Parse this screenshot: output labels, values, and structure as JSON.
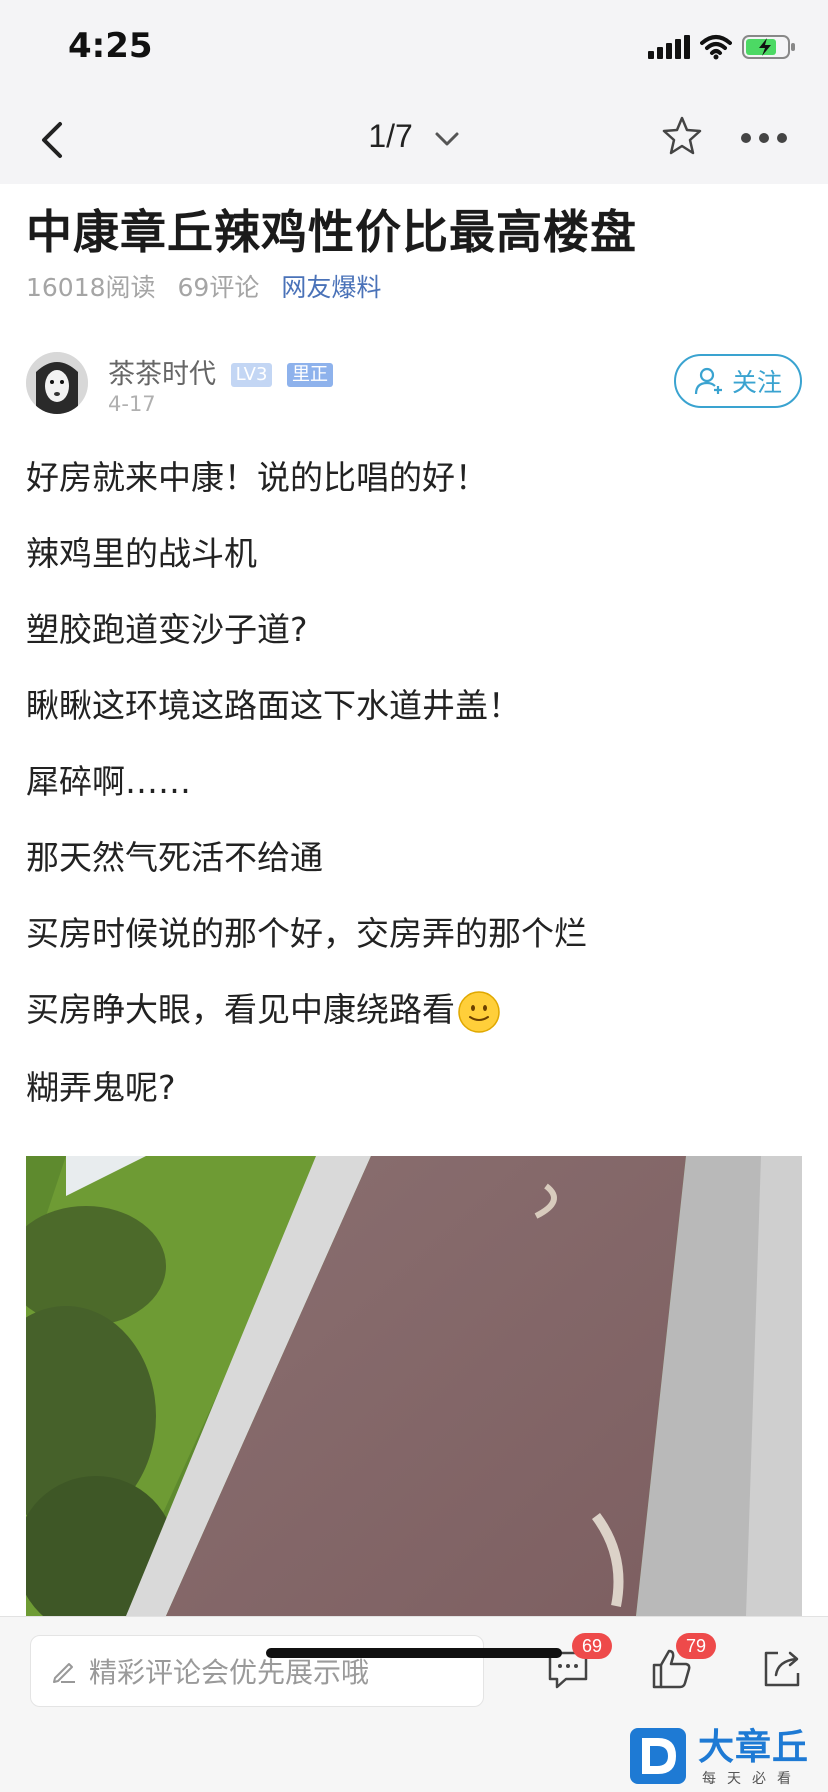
{
  "status_bar": {
    "time": "4:25"
  },
  "nav": {
    "page_indicator": "1/7"
  },
  "article": {
    "title": "中康章丘辣鸡性价比最高楼盘",
    "reads": "16018阅读",
    "comments": "69评论",
    "category": "网友爆料"
  },
  "author": {
    "name": "茶茶时代",
    "level": "LV3",
    "badge": "里正",
    "date": "4-17",
    "follow_label": "关注"
  },
  "content": {
    "lines": [
      "好房就来中康！说的比唱的好！",
      "辣鸡里的战斗机",
      "塑胶跑道变沙子道?",
      "瞅瞅这环境这路面这下水道井盖！",
      "犀碎啊……",
      "那天然气死活不给通",
      "买房时候说的那个好，交房弄的那个烂",
      "买房睁大眼，看见中康绕路看",
      "糊弄鬼呢?"
    ]
  },
  "bottom_bar": {
    "comment_placeholder": "精彩评论会优先展示哦",
    "comment_count": "69",
    "like_count": "79"
  },
  "logo": {
    "name": "大章丘",
    "slogan": "每天必看"
  },
  "colors": {
    "accent": "#3aa3d0",
    "link": "#4a72b8",
    "badge_red": "#ee4a4a",
    "logo_blue": "#1e7ad4"
  }
}
